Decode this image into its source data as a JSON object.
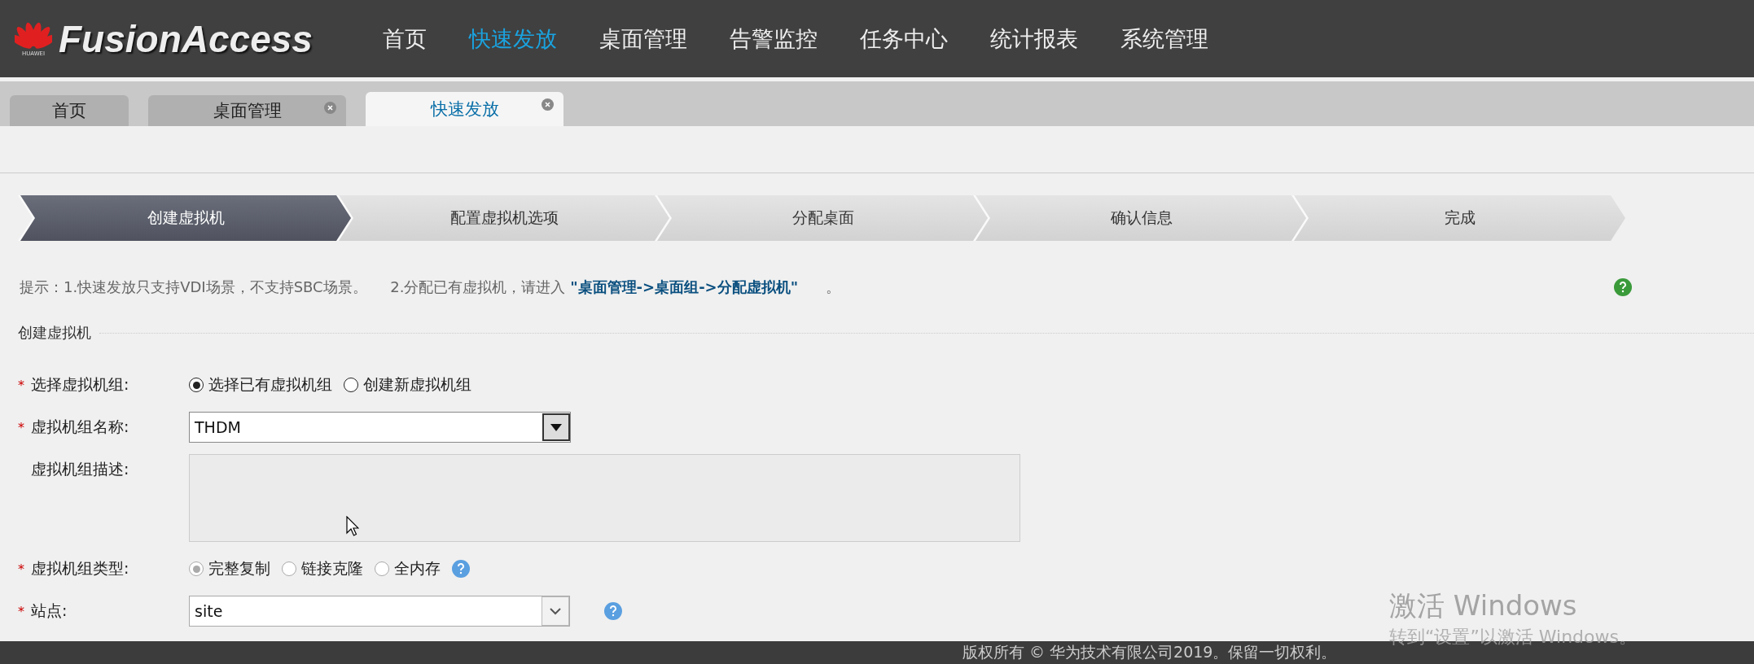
{
  "header": {
    "logo_text": "FusionAccess",
    "brand_caption": "HUAWEI",
    "nav": [
      {
        "label": "首页",
        "selected": false
      },
      {
        "label": "快速发放",
        "selected": true
      },
      {
        "label": "桌面管理",
        "selected": false
      },
      {
        "label": "告警监控",
        "selected": false
      },
      {
        "label": "任务中心",
        "selected": false
      },
      {
        "label": "统计报表",
        "selected": false
      },
      {
        "label": "系统管理",
        "selected": false
      }
    ]
  },
  "tabs": [
    {
      "label": "首页",
      "selected": false,
      "closable": false
    },
    {
      "label": "桌面管理",
      "selected": false,
      "closable": true
    },
    {
      "label": "快速发放",
      "selected": true,
      "closable": true
    }
  ],
  "steps": [
    {
      "label": "创建虚拟机",
      "selected": true
    },
    {
      "label": "配置虚拟机选项",
      "selected": false
    },
    {
      "label": "分配桌面",
      "selected": false
    },
    {
      "label": "确认信息",
      "selected": false
    },
    {
      "label": "完成",
      "selected": false
    }
  ],
  "hint": {
    "lead": "提示：1.快速发放只支持VDI场景，不支持SBC场景。",
    "middle": "2.分配已有虚拟机，请进入",
    "link": "\"桌面管理->桌面组->分配虚拟机\"",
    "end": "。"
  },
  "section_title": "创建虚拟机",
  "form": [
    {
      "kind": "radio",
      "mark": "*",
      "label": "选择虚拟机组:",
      "disabled": false,
      "options": [
        {
          "label": "选择已有虚拟机组",
          "selected": true
        },
        {
          "label": "创建新虚拟机组",
          "selected": false
        }
      ]
    },
    {
      "kind": "combo",
      "mark": "*",
      "label": "虚拟机组名称:",
      "value": "THDM"
    },
    {
      "kind": "textarea",
      "label": "虚拟机组描述:"
    },
    {
      "kind": "radio",
      "mark": "*",
      "label": "虚拟机组类型:",
      "disabled": true,
      "help": true,
      "options": [
        {
          "label": "完整复制",
          "selected": true
        },
        {
          "label": "链接克隆",
          "selected": false
        },
        {
          "label": "全内存",
          "selected": false
        }
      ]
    },
    {
      "kind": "select",
      "mark": "*",
      "label": "站点:",
      "value": "site",
      "help": true
    }
  ],
  "footer": "版权所有 © 华为技术有限公司2019。保留一切权利。",
  "activation": {
    "title": "激活 Windows",
    "subtitle": "转到“设置”以激活 Windows。"
  }
}
